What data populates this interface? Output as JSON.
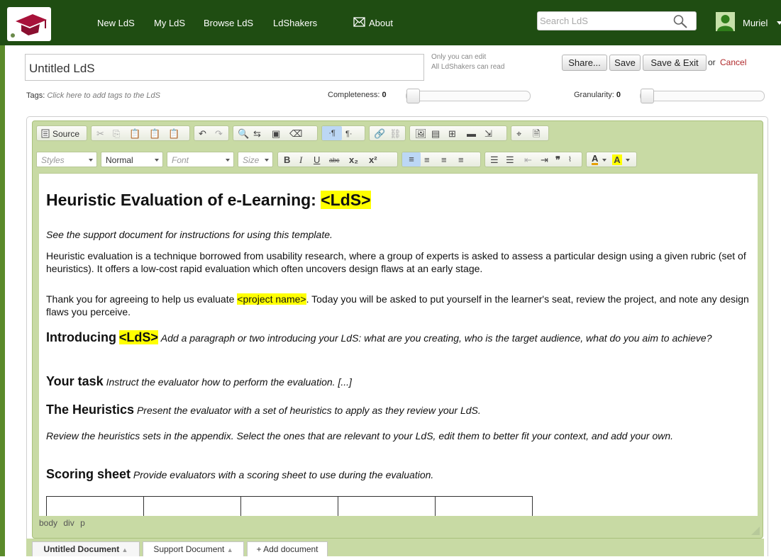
{
  "nav": {
    "links": [
      "New LdS",
      "My LdS",
      "Browse LdS",
      "LdShakers",
      "About"
    ],
    "search_placeholder": "Search LdS",
    "user_name": "Muriel"
  },
  "header": {
    "title_value": "Untitled LdS",
    "permission_line1": "Only you can edit",
    "permission_line2": "All LdShakers can read",
    "share_label": "Share...",
    "save_label": "Save",
    "save_exit_label": "Save & Exit",
    "or_text": "or",
    "cancel_label": "Cancel"
  },
  "meta": {
    "tags_label": "Tags:",
    "tags_hint": "Click here to add tags to the LdS",
    "completeness_label": "Completeness:",
    "completeness_value": "0",
    "granularity_label": "Granularity:",
    "granularity_value": "0"
  },
  "toolbar": {
    "source_label": "Source",
    "styles": "Styles",
    "format": "Normal",
    "font": "Font",
    "size": "Size"
  },
  "document": {
    "heading_prefix": "Heuristic Evaluation of e-Learning:",
    "heading_placeholder": "<LdS>",
    "support_note": "See the support document for instructions for using this template.",
    "intro_paragraph": "Heuristic evaluation is a technique borrowed from usability research, where a group of experts is asked to assess a particular design using a given rubric (set of heuristics). It offers a low-cost rapid evaluation which often uncovers design flaws at an early stage.",
    "thanks_before": "Thank you for agreeing to help us evaluate ",
    "thanks_placeholder": "<project name>",
    "thanks_after": ". Today you will be asked to put yourself in the learner's seat, review the project, and note any design flaws you perceive.",
    "intro_title": "Introducing",
    "intro_placeholder": "<LdS>",
    "intro_text": "Add a paragraph or two introducing your LdS: what are you creating, who is the target audience, what do you aim to achieve?",
    "task_title": "Your task",
    "task_text": "Instruct the evaluator how to perform the evaluation. [...]",
    "heuristics_title": "The Heuristics",
    "heuristics_text": "Present the evaluator with a set of heuristics to apply as they review your LdS.",
    "review_text": "Review the heuristics sets in the appendix. Select the ones that are relevant to your LdS, edit them to better fit your context, and add your own.",
    "scoring_title": "Scoring sheet",
    "scoring_text": "Provide evaluators with a scoring sheet to use during the evaluation."
  },
  "statusbar": [
    "body",
    "div",
    "p"
  ],
  "doc_tabs": [
    "Untitled Document",
    "Support Document",
    "+ Add document"
  ],
  "colors": {
    "nav_bg": "#1f4d12",
    "editor_chrome": "#c8daa4",
    "highlight": "#ffff00",
    "cancel_link": "#b0282a"
  }
}
